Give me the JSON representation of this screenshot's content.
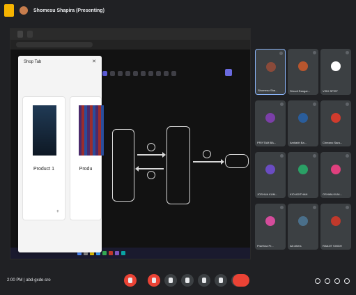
{
  "meeting": {
    "title": "Shomesu Shapira (Presenting)",
    "time_code": "2:00 PM | abd-gxde-sro"
  },
  "browser": {
    "tab_active": "",
    "tab_other": "",
    "url": ""
  },
  "panel": {
    "heading": "Shop Tab",
    "subtitle": "",
    "product1": {
      "name": "Product 1",
      "price": ""
    },
    "product2": {
      "name": "Produ",
      "price": ""
    }
  },
  "diagram": {
    "nodes": [
      "",
      "",
      ""
    ],
    "circles": [
      "",
      ""
    ]
  },
  "participants": [
    {
      "name": "Shomesu Sha...",
      "color": "#8a4a3a"
    },
    {
      "name": "Shrudi Rangar...",
      "color": "#b8562e"
    },
    {
      "name": "VISH SPIST",
      "color": "#ffffff"
    },
    {
      "name": "PRIYTAM BA...",
      "color": "#7b3fa8"
    },
    {
      "name": "Amitabh Ba...",
      "color": "#2a5d9b"
    },
    {
      "name": "Chreano Sara...",
      "color": "#d03b2d"
    },
    {
      "name": "JOSHUA KUM...",
      "color": "#6a4cc2"
    },
    {
      "name": "KIO ADITHAN",
      "color": "#2aa065"
    },
    {
      "name": "OSHMA KUM...",
      "color": "#e0407e"
    },
    {
      "name": "Prarthna Pr...",
      "color": "#d44c9b"
    },
    {
      "name": "All others",
      "color": "#4a6f8a"
    },
    {
      "name": "RANJIT SINGH",
      "color": "#c0392b"
    }
  ],
  "colors": {
    "accent": "#8ab4f8",
    "end_call": "#ea4335",
    "app_badge": "#f6b400"
  }
}
